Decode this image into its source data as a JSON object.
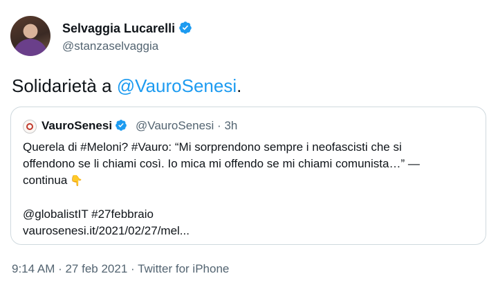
{
  "author": {
    "name": "Selvaggia Lucarelli",
    "handle": "@stanzaselvaggia"
  },
  "tweet": {
    "text_prefix": "Solidarietà a ",
    "mention": "@VauroSenesi",
    "text_suffix": "."
  },
  "quoted": {
    "name": "VauroSenesi",
    "handle_time": "@VauroSenesi · 3h",
    "lines": [
      "Querela di #Meloni? #Vauro: “Mi sorprendono sempre i neofascisti che si",
      "offendono se li chiami così. Io mica mi offendo se mi chiami comunista…” —",
      "continua"
    ],
    "emoji": "👇",
    "tags": "@globalistIT #27febbraio",
    "link": "vaurosenesi.it/2021/02/27/mel..."
  },
  "meta": {
    "timestamp": "9:14 AM · 27 feb 2021 · Twitter for iPhone"
  },
  "colors": {
    "accent": "#1d9bf0",
    "secondary_text": "#536471",
    "border": "#cfd9de"
  },
  "icons": {
    "verified": "verified-badge-icon",
    "pointing": "pointing-down-emoji"
  }
}
